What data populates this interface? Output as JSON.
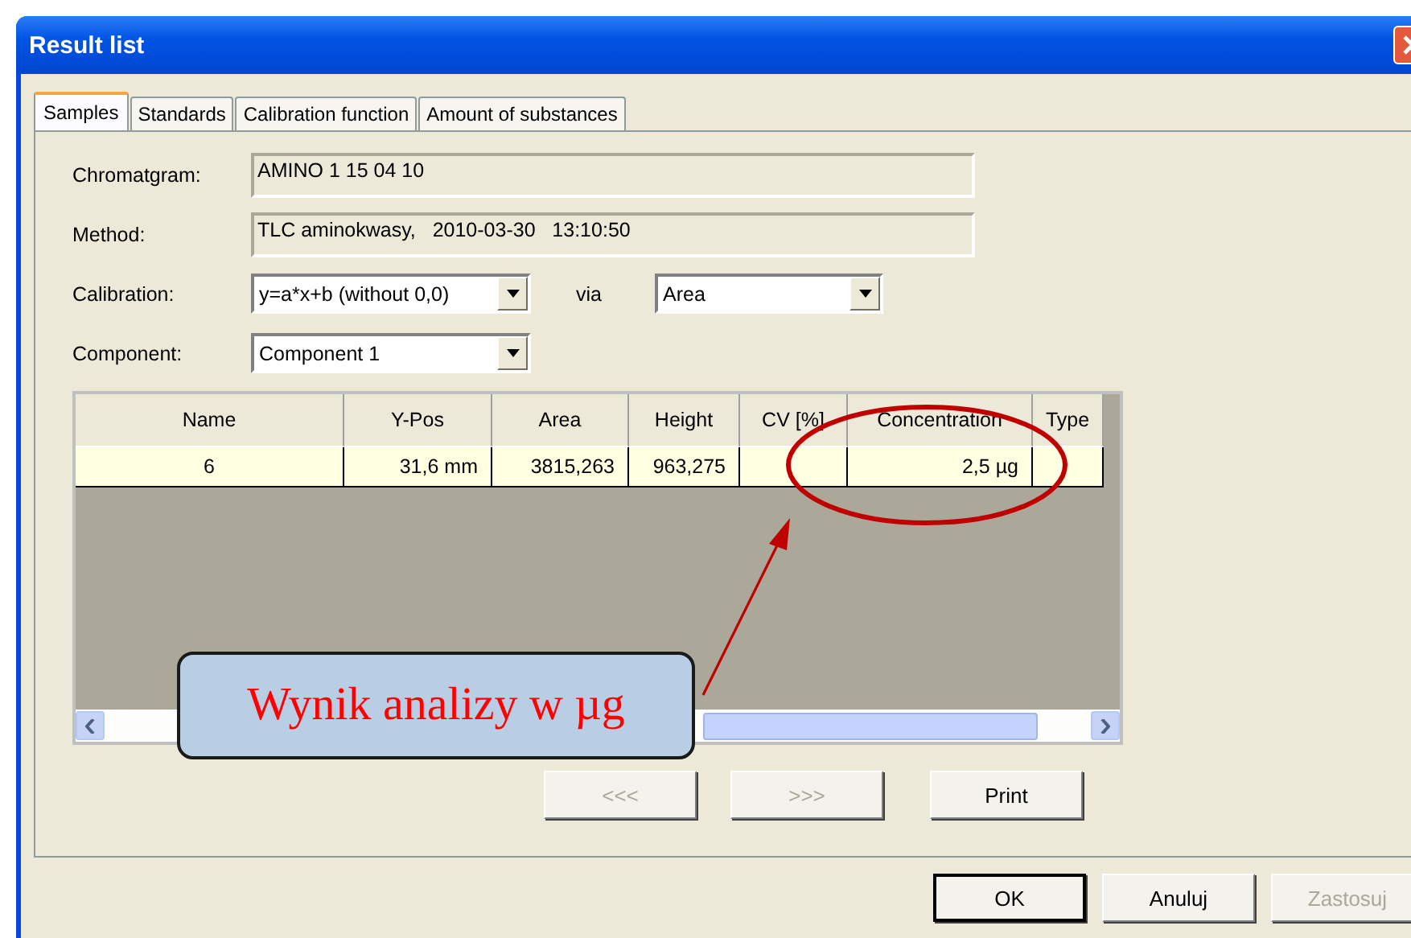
{
  "window": {
    "title": "Result list"
  },
  "tabs": [
    {
      "label": "Samples",
      "selected": true
    },
    {
      "label": "Standards",
      "selected": false
    },
    {
      "label": "Calibration function",
      "selected": false
    },
    {
      "label": "Amount of substances",
      "selected": false
    }
  ],
  "fields": [
    {
      "kind": "text",
      "label": "Chromatgram:",
      "value": "AMINO 1 15 04 10"
    },
    {
      "kind": "text",
      "label": "Method:",
      "value": "TLC aminokwasy,   2010-03-30   13:10:50"
    }
  ],
  "calibration": {
    "label": "Calibration:",
    "value": "y=a*x+b (without 0,0)",
    "via_label": "via",
    "via_value": "Area"
  },
  "component": {
    "label": "Component:",
    "value": "Component 1"
  },
  "table": {
    "columns": [
      "Name",
      "Y-Pos",
      "Area",
      "Height",
      "CV [%]",
      "Concentration",
      "Type"
    ],
    "rows": [
      {
        "cells": [
          "6",
          "31,6 mm",
          "3815,263",
          "963,275",
          "",
          "2,5 µg",
          ""
        ],
        "selected": true
      }
    ]
  },
  "nav_buttons": [
    {
      "label": "<<<",
      "disabled": true
    },
    {
      "label": ">>>",
      "disabled": true
    },
    {
      "label": "Print",
      "disabled": false
    }
  ],
  "dialog_buttons": [
    {
      "label": "OK",
      "disabled": false,
      "default": true
    },
    {
      "label": "Anuluj",
      "disabled": false,
      "default": false
    },
    {
      "label": "Zastosuj",
      "disabled": true,
      "default": false
    }
  ],
  "annotation": {
    "text": "Wynik analizy w µg"
  }
}
